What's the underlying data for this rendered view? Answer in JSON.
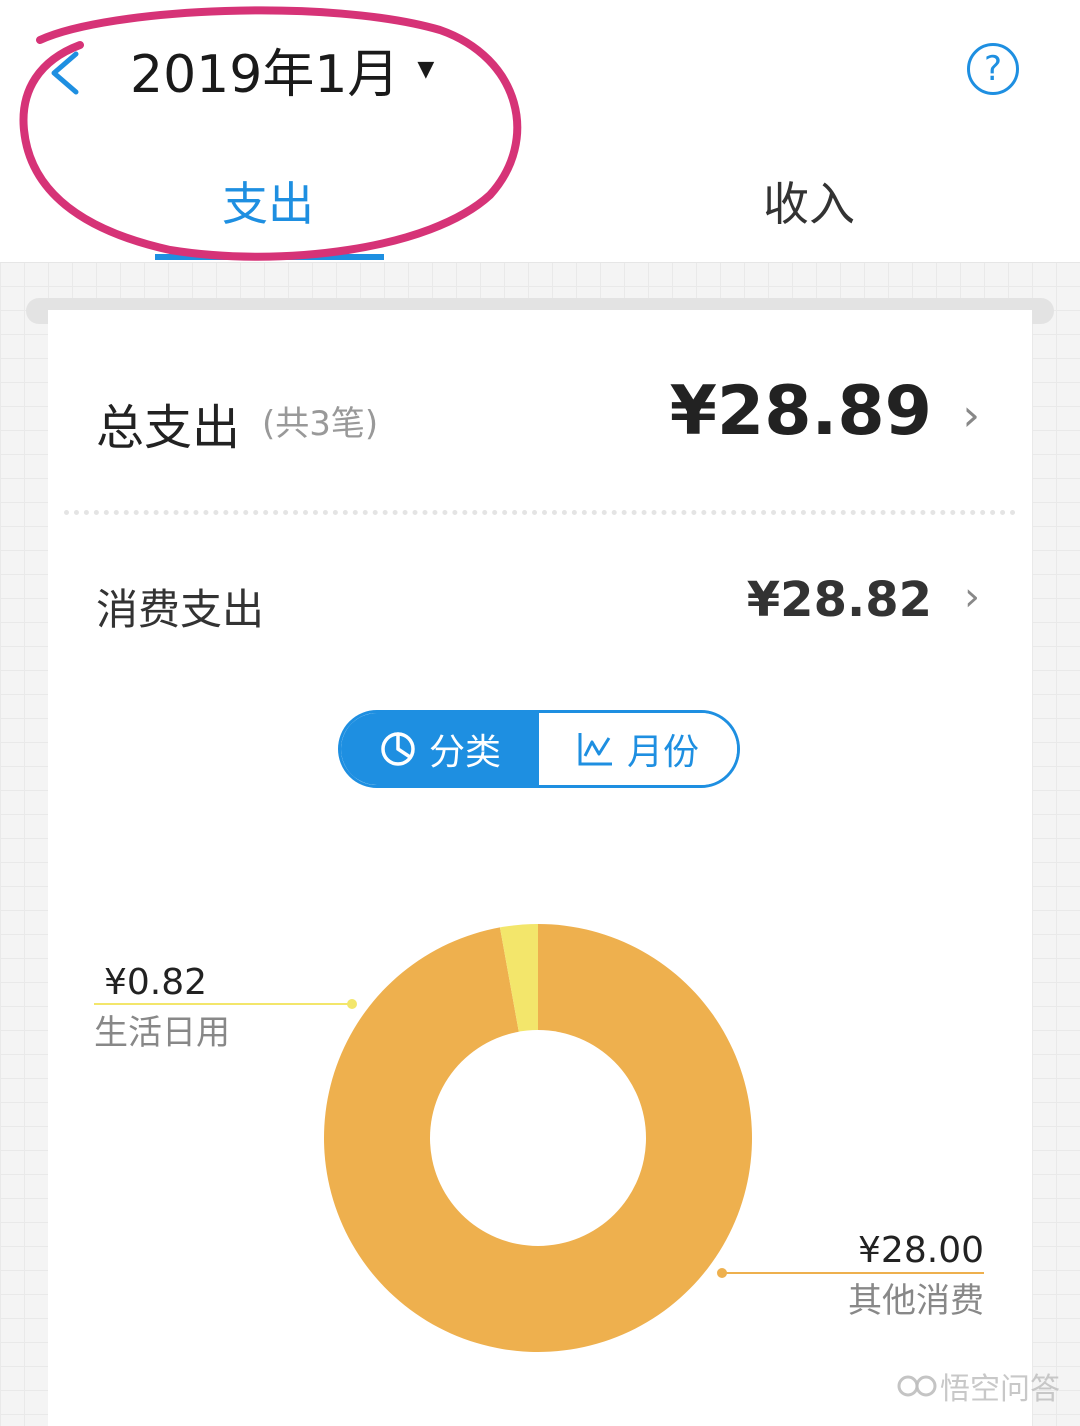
{
  "header": {
    "month": "2019年1月",
    "tabs": [
      {
        "label": "支出",
        "active": true
      },
      {
        "label": "收入",
        "active": false
      }
    ],
    "help_symbol": "?",
    "accent_color": "#1e8fe1",
    "annotation_color": "#d63377"
  },
  "summary": {
    "total_label": "总支出",
    "total_count": "(共3笔)",
    "total_amount": "¥28.89",
    "consume_label": "消费支出",
    "consume_amount": "¥28.82"
  },
  "segment": {
    "category_label": "分类",
    "month_label": "月份",
    "category_icon": "pie-chart-icon",
    "month_icon": "line-chart-icon"
  },
  "chart_data": {
    "type": "pie",
    "donut": true,
    "slices": [
      {
        "name": "其他消费",
        "amount": "¥28.00",
        "value": 28.0,
        "color": "#eeb04e"
      },
      {
        "name": "生活日用",
        "amount": "¥0.82",
        "value": 0.82,
        "color": "#f3e66b"
      }
    ]
  },
  "watermark": "悟空问答"
}
